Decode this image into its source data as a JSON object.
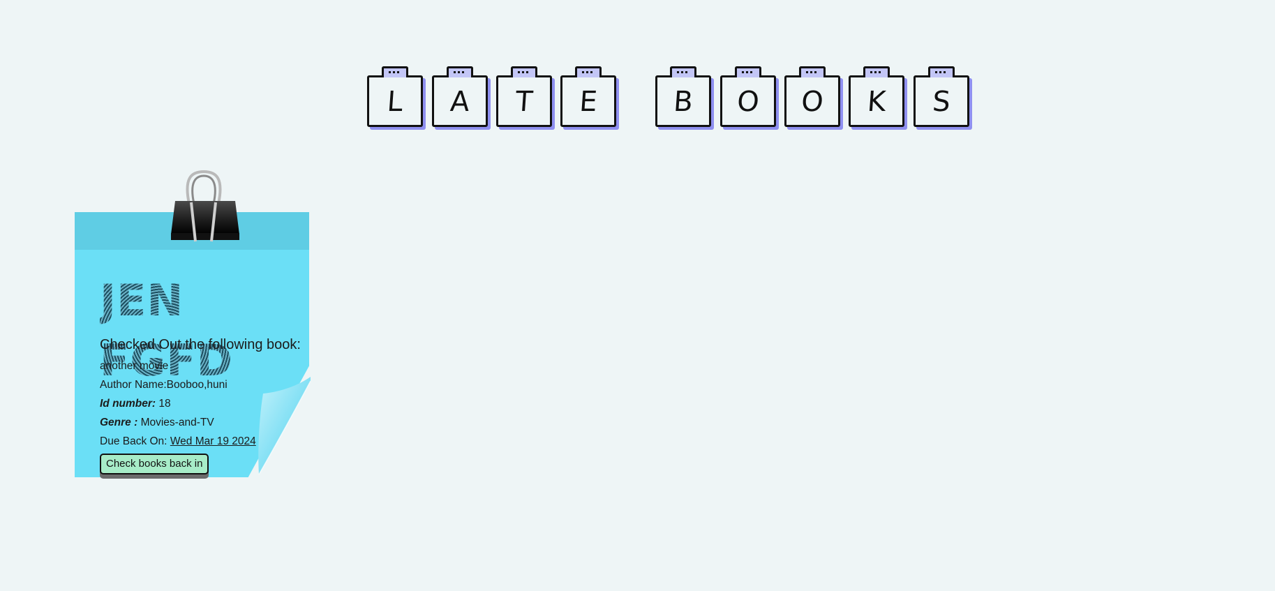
{
  "page_title_letters": [
    "L",
    "A",
    "T",
    "E",
    "B",
    "O",
    "O",
    "K",
    "S"
  ],
  "note": {
    "borrower_name": "JEN FGFD",
    "heading": "Checked Out the following book:",
    "book_title": "another movie",
    "author_label": "Author Name:",
    "author_value": "Booboo,huni",
    "id_label": "Id number:",
    "id_value": "18",
    "genre_label": "Genre :",
    "genre_value": "Movies-and-TV",
    "due_label": "Due Back On:",
    "due_value": "Wed Mar 19 2024",
    "button_label": "Check books back in"
  },
  "colors": {
    "background": "#eef5f6",
    "note": "#6bdff6",
    "letter_shadow": "#8f90f0",
    "button": "#a7ecc8"
  },
  "icons": {
    "binder_clip": "binder-clip-icon",
    "page_curl": "page-curl"
  }
}
